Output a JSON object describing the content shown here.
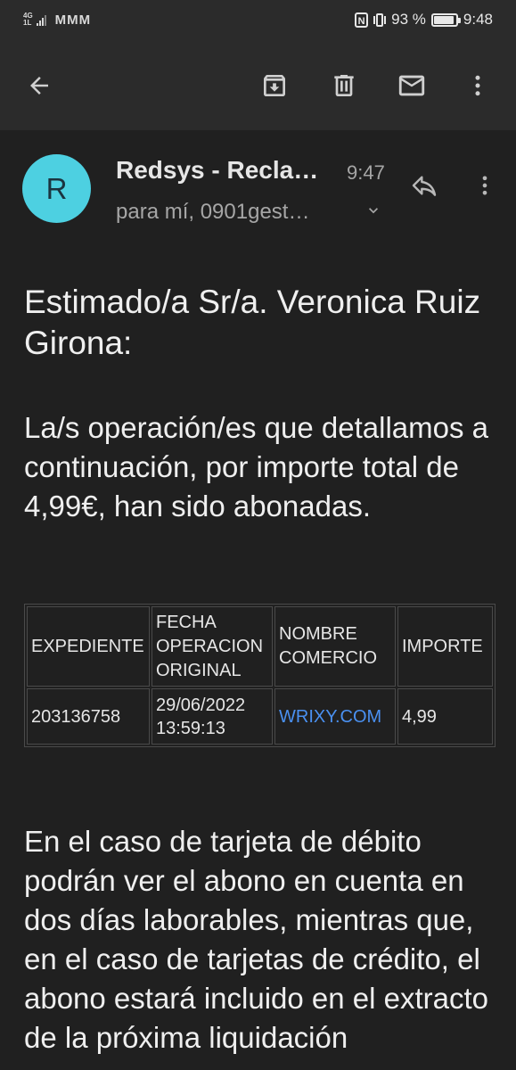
{
  "status_bar": {
    "network": [
      "4G",
      "1L"
    ],
    "carrier_icons": "MMM",
    "battery_percent": "93 %",
    "battery_level": 0.93,
    "time": "9:48"
  },
  "toolbar": {
    "back_icon": "arrow-left-icon",
    "archive_icon": "archive-icon",
    "delete_icon": "trash-icon",
    "mail_icon": "mail-icon",
    "more_icon": "more-vertical-icon"
  },
  "message": {
    "avatar_letter": "R",
    "avatar_color": "#4dd0e1",
    "sender": "Redsys - Recla…",
    "time": "9:47",
    "recipients": "para mí, 0901gest…",
    "greeting": "Estimado/a Sr/a. Veronica Ruiz Girona:",
    "intro": "La/s operación/es que detallamos a continuación, por importe total de 4,99€, han sido abonadas.",
    "table": {
      "headers": [
        "EXPEDIENTE",
        "FECHA OPERACION ORIGINAL",
        "NOMBRE COMERCIO",
        "IMPORTE"
      ],
      "rows": [
        [
          "203136758",
          "29/06/2022 13:59:13",
          "WRIXY.COM",
          "4,99"
        ]
      ]
    },
    "closing": "En el caso de tarjeta de débito podrán ver el abono en cuenta en dos días laborables, mientras que, en el caso de tarjetas de crédito, el abono estará incluido en el extracto de la próxima liquidación"
  },
  "colors": {
    "background": "#202020",
    "toolbar": "#2b2b2b",
    "link": "#4a90f0"
  }
}
